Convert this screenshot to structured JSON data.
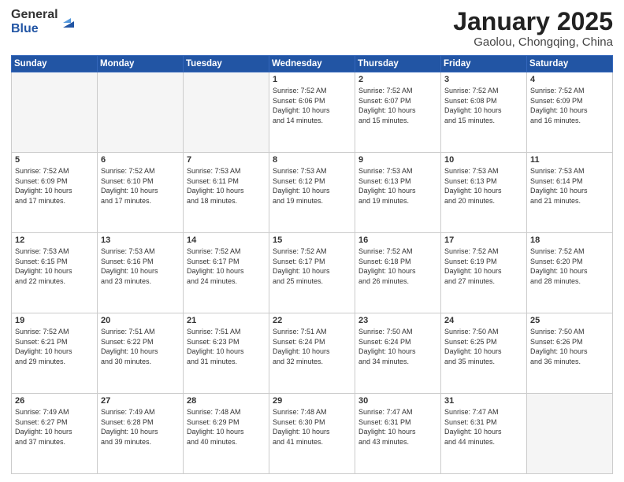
{
  "header": {
    "logo_general": "General",
    "logo_blue": "Blue",
    "month_title": "January 2025",
    "location": "Gaolou, Chongqing, China"
  },
  "weekdays": [
    "Sunday",
    "Monday",
    "Tuesday",
    "Wednesday",
    "Thursday",
    "Friday",
    "Saturday"
  ],
  "weeks": [
    [
      {
        "day": "",
        "text": ""
      },
      {
        "day": "",
        "text": ""
      },
      {
        "day": "",
        "text": ""
      },
      {
        "day": "1",
        "text": "Sunrise: 7:52 AM\nSunset: 6:06 PM\nDaylight: 10 hours\nand 14 minutes."
      },
      {
        "day": "2",
        "text": "Sunrise: 7:52 AM\nSunset: 6:07 PM\nDaylight: 10 hours\nand 15 minutes."
      },
      {
        "day": "3",
        "text": "Sunrise: 7:52 AM\nSunset: 6:08 PM\nDaylight: 10 hours\nand 15 minutes."
      },
      {
        "day": "4",
        "text": "Sunrise: 7:52 AM\nSunset: 6:09 PM\nDaylight: 10 hours\nand 16 minutes."
      }
    ],
    [
      {
        "day": "5",
        "text": "Sunrise: 7:52 AM\nSunset: 6:09 PM\nDaylight: 10 hours\nand 17 minutes."
      },
      {
        "day": "6",
        "text": "Sunrise: 7:52 AM\nSunset: 6:10 PM\nDaylight: 10 hours\nand 17 minutes."
      },
      {
        "day": "7",
        "text": "Sunrise: 7:53 AM\nSunset: 6:11 PM\nDaylight: 10 hours\nand 18 minutes."
      },
      {
        "day": "8",
        "text": "Sunrise: 7:53 AM\nSunset: 6:12 PM\nDaylight: 10 hours\nand 19 minutes."
      },
      {
        "day": "9",
        "text": "Sunrise: 7:53 AM\nSunset: 6:13 PM\nDaylight: 10 hours\nand 19 minutes."
      },
      {
        "day": "10",
        "text": "Sunrise: 7:53 AM\nSunset: 6:13 PM\nDaylight: 10 hours\nand 20 minutes."
      },
      {
        "day": "11",
        "text": "Sunrise: 7:53 AM\nSunset: 6:14 PM\nDaylight: 10 hours\nand 21 minutes."
      }
    ],
    [
      {
        "day": "12",
        "text": "Sunrise: 7:53 AM\nSunset: 6:15 PM\nDaylight: 10 hours\nand 22 minutes."
      },
      {
        "day": "13",
        "text": "Sunrise: 7:53 AM\nSunset: 6:16 PM\nDaylight: 10 hours\nand 23 minutes."
      },
      {
        "day": "14",
        "text": "Sunrise: 7:52 AM\nSunset: 6:17 PM\nDaylight: 10 hours\nand 24 minutes."
      },
      {
        "day": "15",
        "text": "Sunrise: 7:52 AM\nSunset: 6:17 PM\nDaylight: 10 hours\nand 25 minutes."
      },
      {
        "day": "16",
        "text": "Sunrise: 7:52 AM\nSunset: 6:18 PM\nDaylight: 10 hours\nand 26 minutes."
      },
      {
        "day": "17",
        "text": "Sunrise: 7:52 AM\nSunset: 6:19 PM\nDaylight: 10 hours\nand 27 minutes."
      },
      {
        "day": "18",
        "text": "Sunrise: 7:52 AM\nSunset: 6:20 PM\nDaylight: 10 hours\nand 28 minutes."
      }
    ],
    [
      {
        "day": "19",
        "text": "Sunrise: 7:52 AM\nSunset: 6:21 PM\nDaylight: 10 hours\nand 29 minutes."
      },
      {
        "day": "20",
        "text": "Sunrise: 7:51 AM\nSunset: 6:22 PM\nDaylight: 10 hours\nand 30 minutes."
      },
      {
        "day": "21",
        "text": "Sunrise: 7:51 AM\nSunset: 6:23 PM\nDaylight: 10 hours\nand 31 minutes."
      },
      {
        "day": "22",
        "text": "Sunrise: 7:51 AM\nSunset: 6:24 PM\nDaylight: 10 hours\nand 32 minutes."
      },
      {
        "day": "23",
        "text": "Sunrise: 7:50 AM\nSunset: 6:24 PM\nDaylight: 10 hours\nand 34 minutes."
      },
      {
        "day": "24",
        "text": "Sunrise: 7:50 AM\nSunset: 6:25 PM\nDaylight: 10 hours\nand 35 minutes."
      },
      {
        "day": "25",
        "text": "Sunrise: 7:50 AM\nSunset: 6:26 PM\nDaylight: 10 hours\nand 36 minutes."
      }
    ],
    [
      {
        "day": "26",
        "text": "Sunrise: 7:49 AM\nSunset: 6:27 PM\nDaylight: 10 hours\nand 37 minutes."
      },
      {
        "day": "27",
        "text": "Sunrise: 7:49 AM\nSunset: 6:28 PM\nDaylight: 10 hours\nand 39 minutes."
      },
      {
        "day": "28",
        "text": "Sunrise: 7:48 AM\nSunset: 6:29 PM\nDaylight: 10 hours\nand 40 minutes."
      },
      {
        "day": "29",
        "text": "Sunrise: 7:48 AM\nSunset: 6:30 PM\nDaylight: 10 hours\nand 41 minutes."
      },
      {
        "day": "30",
        "text": "Sunrise: 7:47 AM\nSunset: 6:31 PM\nDaylight: 10 hours\nand 43 minutes."
      },
      {
        "day": "31",
        "text": "Sunrise: 7:47 AM\nSunset: 6:31 PM\nDaylight: 10 hours\nand 44 minutes."
      },
      {
        "day": "",
        "text": ""
      }
    ]
  ]
}
